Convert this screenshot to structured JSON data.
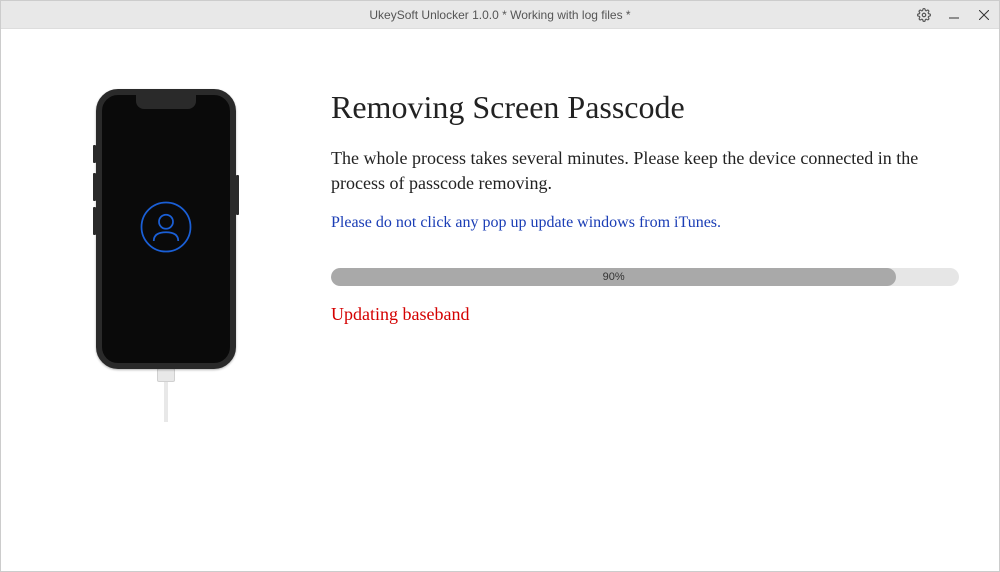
{
  "window": {
    "title": "UkeySoft Unlocker 1.0.0 * Working with log files *"
  },
  "main": {
    "heading": "Removing Screen Passcode",
    "description": "The whole process takes several minutes. Please keep the device connected in the process of passcode removing.",
    "warning": "Please do not click any pop up update windows from iTunes.",
    "progress_percent": 90,
    "progress_label": "90%",
    "status": "Updating baseband"
  }
}
